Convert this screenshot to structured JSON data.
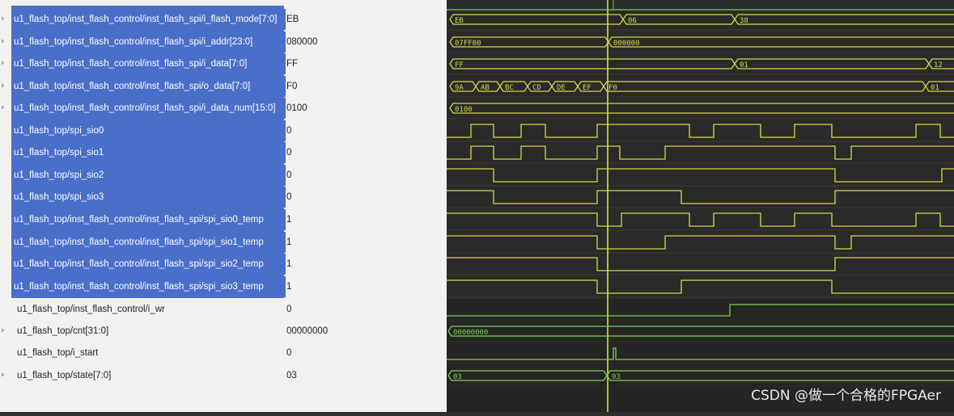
{
  "signals": [
    {
      "name": "u1_flash_top/inst_flash_control/inst_flash_spi/i_flash_mode[7:0]",
      "value": "EB",
      "expandable": true,
      "selected": true
    },
    {
      "name": "u1_flash_top/inst_flash_control/inst_flash_spi/i_addr[23:0]",
      "value": "080000",
      "expandable": true,
      "selected": true
    },
    {
      "name": "u1_flash_top/inst_flash_control/inst_flash_spi/i_data[7:0]",
      "value": "FF",
      "expandable": true,
      "selected": true
    },
    {
      "name": "u1_flash_top/inst_flash_control/inst_flash_spi/o_data[7:0]",
      "value": "F0",
      "expandable": true,
      "selected": true
    },
    {
      "name": "u1_flash_top/inst_flash_control/inst_flash_spi/i_data_num[15:0]",
      "value": "0100",
      "expandable": true,
      "selected": true
    },
    {
      "name": "u1_flash_top/spi_sio0",
      "value": "0",
      "expandable": false,
      "selected": true
    },
    {
      "name": "u1_flash_top/spi_sio1",
      "value": "0",
      "expandable": false,
      "selected": true
    },
    {
      "name": "u1_flash_top/spi_sio2",
      "value": "0",
      "expandable": false,
      "selected": true
    },
    {
      "name": "u1_flash_top/spi_sio3",
      "value": "0",
      "expandable": false,
      "selected": true
    },
    {
      "name": "u1_flash_top/inst_flash_control/inst_flash_spi/spi_sio0_temp",
      "value": "1",
      "expandable": false,
      "selected": true
    },
    {
      "name": "u1_flash_top/inst_flash_control/inst_flash_spi/spi_sio1_temp",
      "value": "1",
      "expandable": false,
      "selected": true
    },
    {
      "name": "u1_flash_top/inst_flash_control/inst_flash_spi/spi_sio2_temp",
      "value": "1",
      "expandable": false,
      "selected": true
    },
    {
      "name": "u1_flash_top/inst_flash_control/inst_flash_spi/spi_sio3_temp",
      "value": "1",
      "expandable": false,
      "selected": true
    },
    {
      "name": "u1_flash_top/inst_flash_control/i_wr",
      "value": "0",
      "expandable": false,
      "selected": false
    },
    {
      "name": "u1_flash_top/cnt[31:0]",
      "value": "00000000",
      "expandable": true,
      "selected": false
    },
    {
      "name": "u1_flash_top/i_start",
      "value": "0",
      "expandable": false,
      "selected": false
    },
    {
      "name": "u1_flash_top/state[7:0]",
      "value": "03",
      "expandable": true,
      "selected": false
    }
  ],
  "waveforms": {
    "bus_labels": {
      "i_flash_mode": [
        "EB",
        "06",
        "38"
      ],
      "i_addr": [
        "07FF00",
        "000000"
      ],
      "i_data": [
        "FF",
        "01",
        "12"
      ],
      "o_data": [
        "9A",
        "AB",
        "BC",
        "CD",
        "DE",
        "EF",
        "F0",
        "01"
      ],
      "i_data_num": [
        "0100"
      ],
      "cnt": [
        "00000000"
      ],
      "state": [
        "03",
        "03"
      ]
    }
  },
  "watermark": "CSDN @做一个合格的FPGAer",
  "colors": {
    "selection": "#4a6fc9",
    "wave": "#d6d64a",
    "wave_green": "#7fd14a",
    "cursor": "#e6e63a",
    "background": "#2a2b28"
  }
}
